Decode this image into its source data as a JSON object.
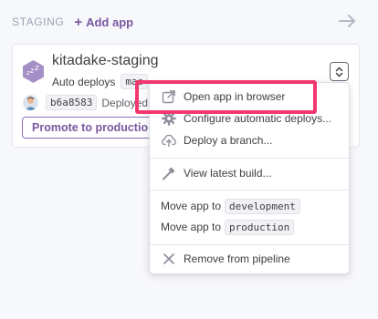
{
  "stage": {
    "title": "STAGING",
    "add_app_label": "Add app"
  },
  "card": {
    "app_name": "kitadake-staging",
    "auto_deploy_text": "Auto deploys",
    "branch": "mas",
    "commit": "b6a8583",
    "deployed_text": "Deployed a",
    "promote_label": "Promote to production..."
  },
  "menu": {
    "items": [
      {
        "label": "Open app in browser",
        "icon": "external-link-icon"
      },
      {
        "label": "Configure automatic deploys...",
        "icon": "gear-icon"
      },
      {
        "label": "Deploy a branch...",
        "icon": "upload-icon"
      },
      {
        "label": "View latest build...",
        "icon": "hammer-icon"
      },
      {
        "label": "Move app to",
        "target": "development"
      },
      {
        "label": "Move app to",
        "target": "production"
      },
      {
        "label": "Remove from pipeline",
        "icon": "close-icon"
      }
    ]
  },
  "colors": {
    "accent": "#79589f",
    "highlight": "#f2386f",
    "background": "#f7f8fb"
  }
}
